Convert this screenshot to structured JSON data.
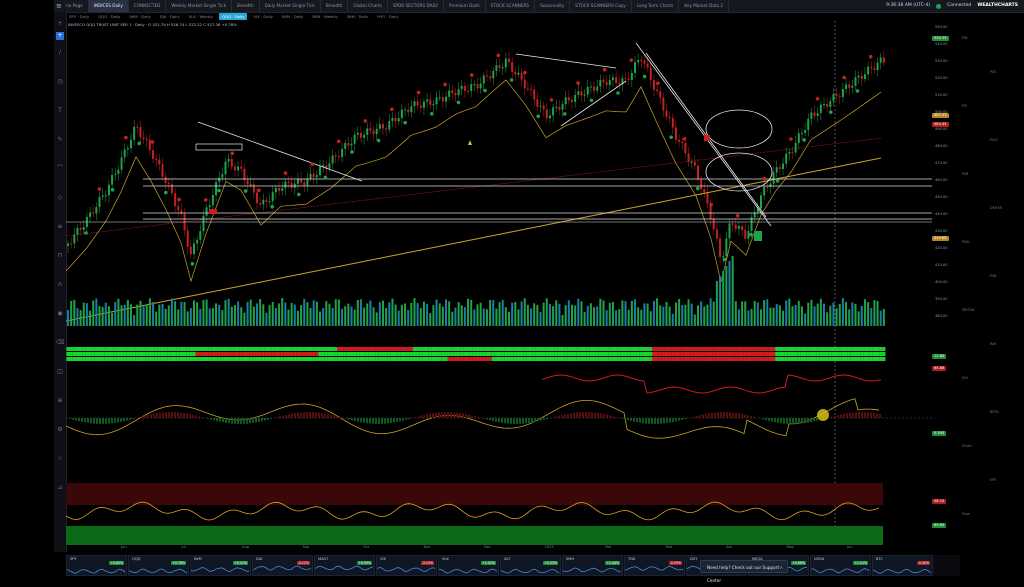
{
  "tabs": [
    "Home Page",
    "INDICES Daily",
    "CONNECTED",
    "Weekly Market Single Tick",
    "Breadth",
    "Daily Market Single Tick",
    "Breadth",
    "Global Charts",
    "SPDR SECTORS DAILY",
    "Premium Dash",
    "STOCK SCANNERS",
    "Seasonality",
    "STOCK SCANNERS Copy",
    "Long Term Charts",
    "Key Market Data 2"
  ],
  "active_tab": "INDICES Daily",
  "top_right": {
    "time": "9:36:38 AM (UTC-4)",
    "status": "Connected",
    "brand": "WEALTHCHARTS"
  },
  "toolbar_items": [
    "SPY · Daily",
    "QQQ · Daily",
    "IWM · Daily",
    "DIA · Daily",
    "XLK · Weekly",
    "QQQ · Daily",
    "VIX · Daily",
    "IWM · Daily",
    "IWM · Weekly",
    "IWM · Daily",
    "HYG · Daily"
  ],
  "active_toolbar": "QQQ · Daily",
  "legend": {
    "line1": "INVESCO QQQ TRUST UNIT SER 1 · Daily  ·  O 522.79  H 526.74  L 522.22  C 527.36  +0.78%",
    "line2": "WEALTHCHARTS"
  },
  "price_axis": [
    "550.00",
    "540.00",
    "530.00",
    "520.00",
    "510.00",
    "500.00",
    "490.00",
    "480.00",
    "470.00",
    "460.00",
    "450.00",
    "440.00",
    "430.00",
    "420.00",
    "410.00",
    "400.00",
    "390.00",
    "380.00"
  ],
  "price_boxes": [
    {
      "label": "550.39",
      "color": "#1f8f3a"
    },
    {
      "label": "487.23",
      "color": "#b8861b"
    },
    {
      "label": "484.45",
      "color": "#b21f1f"
    },
    {
      "label": "449.68",
      "color": "#b8861b"
    }
  ],
  "indicator_boxes": [
    {
      "label": "12.80",
      "color": "#1f8f3a"
    },
    {
      "label": "64.86",
      "color": "#b21f1f"
    },
    {
      "label": "0.393",
      "color": "#1f8f3a"
    },
    {
      "label": "58.10",
      "color": "#b21f1f"
    },
    {
      "label": "69.65",
      "color": "#1f8f3a"
    }
  ],
  "far_right_labels": [
    "P/B",
    "Pi/S",
    "P/E",
    "Pi/CF",
    "Pi/B",
    "DEBT/E",
    "Pi/SL",
    "Pi/B",
    "EBITDA",
    "RoE",
    "DIV",
    "BETA",
    "52wH",
    "EPS",
    "Flow"
  ],
  "x_axis": [
    "Jun",
    "Jul",
    "Aug",
    "Sep",
    "Oct",
    "Nov",
    "Dec",
    "2025",
    "Feb",
    "Mar",
    "Apr",
    "May",
    "Jun"
  ],
  "watchlist": [
    {
      "sym": "SPY",
      "chg": "+0.62%",
      "color": "#1f8f3a"
    },
    {
      "sym": "QQQ",
      "chg": "+0.78%",
      "color": "#1f8f3a"
    },
    {
      "sym": "IWM",
      "chg": "+0.41%",
      "color": "#1f8f3a"
    },
    {
      "sym": "DIA",
      "chg": "-0.12%",
      "color": "#b21f1f"
    },
    {
      "sym": "MAG7",
      "chg": "+0.95%",
      "color": "#1f8f3a"
    },
    {
      "sym": "VIX",
      "chg": "-3.10%",
      "color": "#b21f1f"
    },
    {
      "sym": "XLK",
      "chg": "+1.02%",
      "color": "#1f8f3a"
    },
    {
      "sym": "XLF",
      "chg": "+0.33%",
      "color": "#1f8f3a"
    },
    {
      "sym": "SMH",
      "chg": "+1.44%",
      "color": "#1f8f3a"
    },
    {
      "sym": "TNX",
      "chg": "-0.55%",
      "color": "#b21f1f"
    },
    {
      "sym": "DXY",
      "chg": "+0.21%",
      "color": "#1f8f3a"
    },
    {
      "sym": "MEGA",
      "chg": "+0.66%",
      "color": "#1f8f3a"
    },
    {
      "sym": "NVDA",
      "chg": "+1.21%",
      "color": "#1f8f3a"
    },
    {
      "sym": "BTC",
      "chg": "-0.40%",
      "color": "#b21f1f"
    }
  ],
  "support": {
    "text": "Need help? Check out our Support Center",
    "close": "×"
  },
  "colors": {
    "up": "#1fa34a",
    "down": "#c62121",
    "ma_gold": "#c9a227",
    "ma_red": "#a01c1c",
    "accent": "#2aa8d8"
  }
}
